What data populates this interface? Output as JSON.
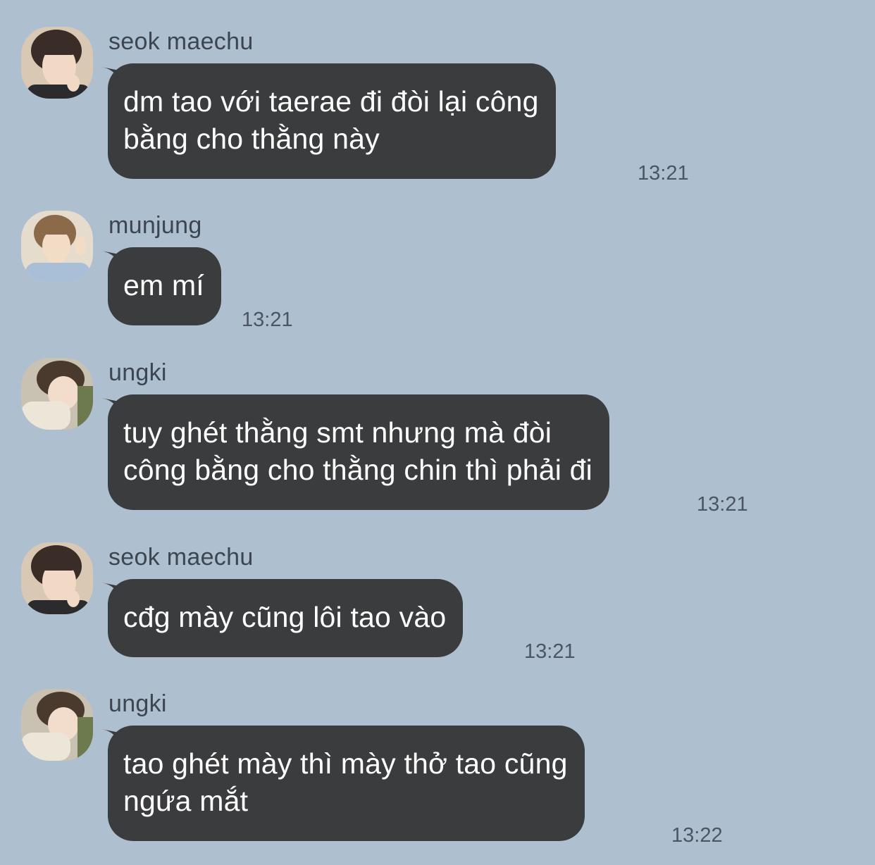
{
  "messages": [
    {
      "sender": "seok maechu",
      "avatar": "avatar-seok-maechu",
      "lines": [
        "dm tao với taerae đi đòi lại công",
        "bằng cho thằng này"
      ],
      "time": "13:21"
    },
    {
      "sender": "munjung",
      "avatar": "avatar-munjung",
      "lines": [
        "em mí"
      ],
      "time": "13:21"
    },
    {
      "sender": "ungki",
      "avatar": "avatar-ungki",
      "lines": [
        "tuy ghét thằng smt nhưng mà đòi",
        "công bằng cho thằng chin thì phải đi"
      ],
      "time": "13:21"
    },
    {
      "sender": "seok maechu",
      "avatar": "avatar-seok-maechu",
      "lines": [
        "cđg mày cũng lôi tao vào"
      ],
      "time": "13:21"
    },
    {
      "sender": "ungki",
      "avatar": "avatar-ungki",
      "lines": [
        "tao ghét mày thì mày thở tao cũng",
        "ngứa mắt"
      ],
      "time": "13:22"
    }
  ],
  "colors": {
    "background": "#aebfd0",
    "bubble": "#3b3c3e",
    "bubble_text": "#ffffff",
    "sender_text": "#3c4650",
    "time_text": "#4a5663"
  }
}
